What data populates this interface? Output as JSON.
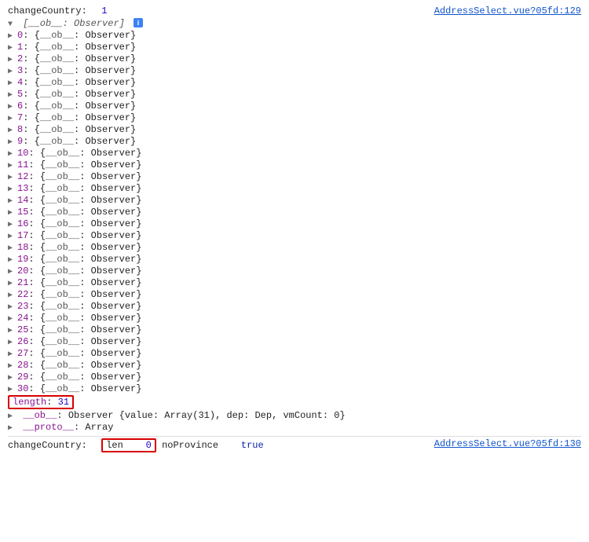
{
  "log1": {
    "label": "changeCountry:",
    "value": "1",
    "source": "AddressSelect.vue?05fd:129",
    "header_open": "[",
    "header_ob": "__ob__",
    "header_sep": ": ",
    "header_type": "Observer",
    "header_close": "]",
    "items": [
      {
        "idx": "0",
        "ob": "__ob__",
        "type": "Observer"
      },
      {
        "idx": "1",
        "ob": "__ob__",
        "type": "Observer"
      },
      {
        "idx": "2",
        "ob": "__ob__",
        "type": "Observer"
      },
      {
        "idx": "3",
        "ob": "__ob__",
        "type": "Observer"
      },
      {
        "idx": "4",
        "ob": "__ob__",
        "type": "Observer"
      },
      {
        "idx": "5",
        "ob": "__ob__",
        "type": "Observer"
      },
      {
        "idx": "6",
        "ob": "__ob__",
        "type": "Observer"
      },
      {
        "idx": "7",
        "ob": "__ob__",
        "type": "Observer"
      },
      {
        "idx": "8",
        "ob": "__ob__",
        "type": "Observer"
      },
      {
        "idx": "9",
        "ob": "__ob__",
        "type": "Observer"
      },
      {
        "idx": "10",
        "ob": "__ob__",
        "type": "Observer"
      },
      {
        "idx": "11",
        "ob": "__ob__",
        "type": "Observer"
      },
      {
        "idx": "12",
        "ob": "__ob__",
        "type": "Observer"
      },
      {
        "idx": "13",
        "ob": "__ob__",
        "type": "Observer"
      },
      {
        "idx": "14",
        "ob": "__ob__",
        "type": "Observer"
      },
      {
        "idx": "15",
        "ob": "__ob__",
        "type": "Observer"
      },
      {
        "idx": "16",
        "ob": "__ob__",
        "type": "Observer"
      },
      {
        "idx": "17",
        "ob": "__ob__",
        "type": "Observer"
      },
      {
        "idx": "18",
        "ob": "__ob__",
        "type": "Observer"
      },
      {
        "idx": "19",
        "ob": "__ob__",
        "type": "Observer"
      },
      {
        "idx": "20",
        "ob": "__ob__",
        "type": "Observer"
      },
      {
        "idx": "21",
        "ob": "__ob__",
        "type": "Observer"
      },
      {
        "idx": "22",
        "ob": "__ob__",
        "type": "Observer"
      },
      {
        "idx": "23",
        "ob": "__ob__",
        "type": "Observer"
      },
      {
        "idx": "24",
        "ob": "__ob__",
        "type": "Observer"
      },
      {
        "idx": "25",
        "ob": "__ob__",
        "type": "Observer"
      },
      {
        "idx": "26",
        "ob": "__ob__",
        "type": "Observer"
      },
      {
        "idx": "27",
        "ob": "__ob__",
        "type": "Observer"
      },
      {
        "idx": "28",
        "ob": "__ob__",
        "type": "Observer"
      },
      {
        "idx": "29",
        "ob": "__ob__",
        "type": "Observer"
      },
      {
        "idx": "30",
        "ob": "__ob__",
        "type": "Observer"
      }
    ],
    "length_key": "length",
    "length_val": "31",
    "ob_key": "__ob__",
    "ob_summary_type": "Observer",
    "ob_summary_body_open": "{",
    "ob_summary_body": "value: Array(31), dep: Dep, vmCount: 0",
    "ob_summary_body_close": "}",
    "proto_key": "__proto__",
    "proto_val": "Array"
  },
  "log2": {
    "label": "changeCountry:",
    "len_key": "len",
    "len_val": "0",
    "noprov_key": "noProvince",
    "noprov_val": "true",
    "source": "AddressSelect.vue?05fd:130"
  }
}
